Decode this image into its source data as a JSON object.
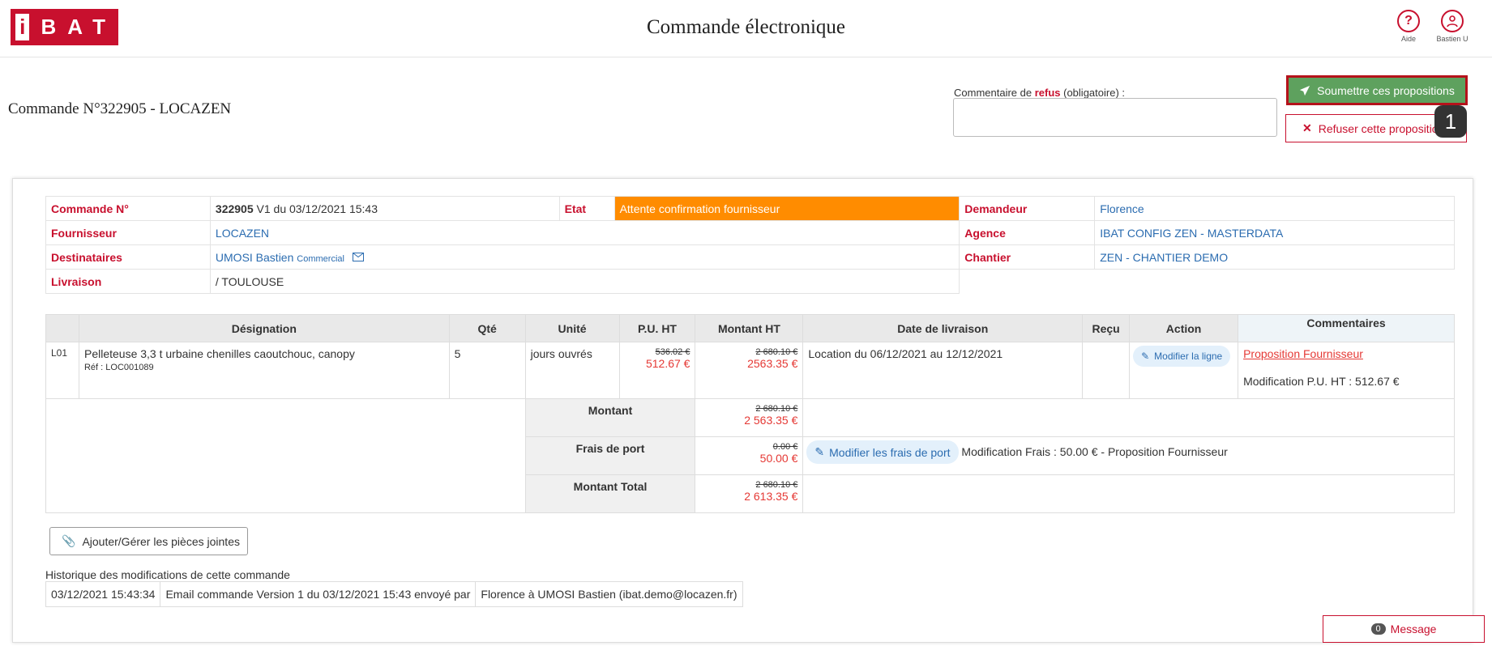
{
  "header": {
    "logo_i": "i",
    "logo_bat": "BAT",
    "title": "Commande électronique",
    "help_label": "Aide",
    "user_label": "Bastien U"
  },
  "order": {
    "title": "Commande N°322905 - LOCAZEN",
    "refus_label_pre": "Commentaire de ",
    "refus_label_bold": "refus",
    "refus_label_post": " (obligatoire) :",
    "refus_value": "",
    "submit_label": "Soumettre ces propositions",
    "refuse_label": "Refuser cette proposition",
    "step_badge": "1"
  },
  "info": {
    "commande_label": "Commande N°",
    "commande_num": "322905",
    "commande_rest": " V1 du 03/12/2021 15:43",
    "etat_label": "Etat",
    "etat_value": "Attente confirmation fournisseur",
    "demandeur_label": "Demandeur",
    "demandeur_value": "Florence",
    "fournisseur_label": "Fournisseur",
    "fournisseur_value": "LOCAZEN",
    "agence_label": "Agence",
    "agence_value": "IBAT CONFIG ZEN - MASTERDATA",
    "destinataires_label": "Destinataires",
    "destinataire_name": "UMOSI Bastien",
    "destinataire_role": "Commercial",
    "chantier_label": "Chantier",
    "chantier_value": "ZEN - CHANTIER DEMO",
    "livraison_label": "Livraison",
    "livraison_value": "/ TOULOUSE"
  },
  "lines": {
    "headers": {
      "designation": "Désignation",
      "qte": "Qté",
      "unite": "Unité",
      "pu": "P.U. HT",
      "montant": "Montant HT",
      "date": "Date de livraison",
      "recu": "Reçu",
      "action": "Action",
      "commentaires": "Commentaires"
    },
    "row": {
      "code": "L01",
      "designation": "Pelleteuse 3,3 t urbaine chenilles caoutchouc, canopy",
      "ref": "Réf : LOC001089",
      "qte": "5",
      "unite": "jours ouvrés",
      "pu_old": "536.02 €",
      "pu_new": "512.67 €",
      "montant_old": "2 680.10 €",
      "montant_new": "2563.35 €",
      "date": "Location du 06/12/2021 au 12/12/2021",
      "recu": "",
      "action_label": "Modifier la ligne",
      "comment_link": "Proposition Fournisseur",
      "comment_text": "Modification P.U. HT : 512.67 €"
    },
    "totals": {
      "montant_label": "Montant",
      "montant_old": "2 680.10 €",
      "montant_new": "2 563.35 €",
      "frais_label": "Frais de port",
      "frais_old": "0.00 €",
      "frais_new": "50.00 €",
      "frais_action": "Modifier les frais de port",
      "frais_comment": "Modification Frais : 50.00 € - Proposition Fournisseur",
      "total_label": "Montant Total",
      "total_old": "2 680.10 €",
      "total_new": "2 613.35 €"
    }
  },
  "attachments_label": "Ajouter/Gérer les pièces jointes",
  "history": {
    "title": "Historique des modifications de cette commande",
    "date": "03/12/2021 15:43:34",
    "desc": "Email commande Version 1 du 03/12/2021 15:43 envoyé par",
    "who": "Florence à UMOSI Bastien (ibat.demo@locazen.fr)"
  },
  "message": {
    "count": "0",
    "label": "Message"
  },
  "colors": {
    "brand_red": "#c8102e",
    "submit_green": "#5ea15e",
    "etat_orange": "#ff8c00",
    "link_blue": "#2b6cb0"
  }
}
